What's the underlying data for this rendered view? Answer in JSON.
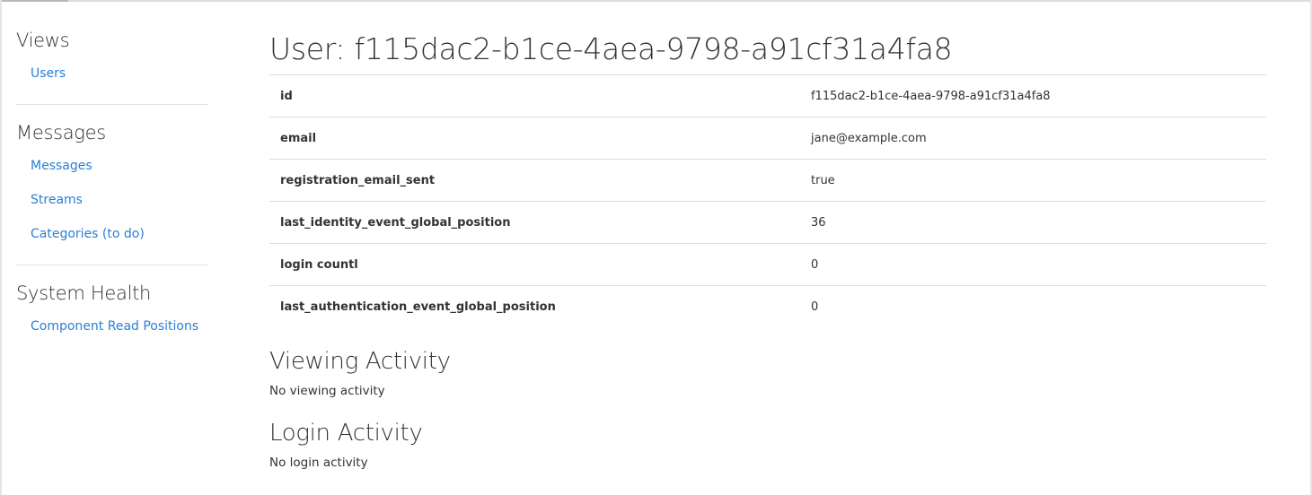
{
  "sidebar": {
    "sections": [
      {
        "heading": "Views",
        "links": [
          "Users"
        ]
      },
      {
        "heading": "Messages",
        "links": [
          "Messages",
          "Streams",
          "Categories (to do)"
        ]
      },
      {
        "heading": "System Health",
        "links": [
          "Component Read Positions"
        ]
      }
    ]
  },
  "main": {
    "title": "User: f115dac2-b1ce-4aea-9798-a91cf31a4fa8",
    "details": [
      {
        "key": "id",
        "value": "f115dac2-b1ce-4aea-9798-a91cf31a4fa8"
      },
      {
        "key": "email",
        "value": "jane@example.com"
      },
      {
        "key": "registration_email_sent",
        "value": "true"
      },
      {
        "key": "last_identity_event_global_position",
        "value": "36"
      },
      {
        "key": "login countl",
        "value": "0"
      },
      {
        "key": "last_authentication_event_global_position",
        "value": "0"
      }
    ],
    "viewing_activity": {
      "title": "Viewing Activity",
      "empty_text": "No viewing activity"
    },
    "login_activity": {
      "title": "Login Activity",
      "empty_text": "No login activity"
    }
  },
  "colors": {
    "link": "#2a7fd4",
    "text": "#333333",
    "divider": "#dddddd"
  }
}
